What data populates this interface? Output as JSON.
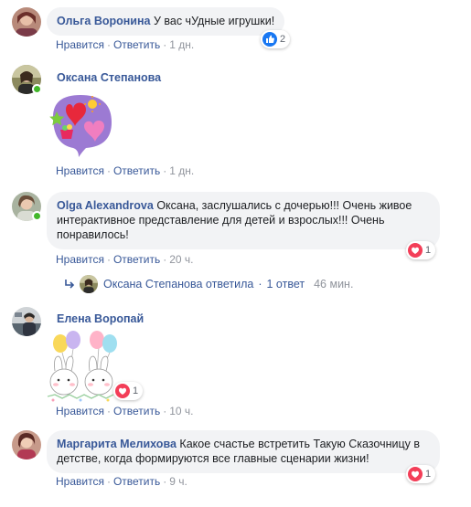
{
  "comments": [
    {
      "author": "Ольга Воронина",
      "text": "У вас чУдные игрушки!",
      "like_label": "Нравится",
      "reply_label": "Ответить",
      "time": "1 дн.",
      "reaction": {
        "icon": "like-icon",
        "count": "2"
      }
    },
    {
      "author": "Оксана Степанова",
      "sticker": "hearts-speech-bubble-sticker",
      "like_label": "Нравится",
      "reply_label": "Ответить",
      "time": "1 дн."
    },
    {
      "author": "Olga Alexandrova",
      "text": "Оксана, заслушались с дочерью!!! Очень живое интерактивное представление для детей и взрослых!!! Очень понравилось!",
      "like_label": "Нравится",
      "reply_label": "Ответить",
      "time": "20 ч.",
      "reaction": {
        "icon": "love-icon",
        "count": "1"
      },
      "replies": {
        "author_replied": "Оксана Степанова ответила",
        "count_label": "1 ответ",
        "time": "46 мин."
      }
    },
    {
      "author": "Елена Воропай",
      "sticker": "bunnies-balloons-sticker",
      "like_label": "Нравится",
      "reply_label": "Ответить",
      "time": "10 ч.",
      "reaction": {
        "icon": "love-icon",
        "count": "1"
      }
    },
    {
      "author": "Маргарита Мелихова",
      "text": "Какое счастье встретить Такую Сказочницу в детстве, когда формируются все главные сценарии жизни!",
      "like_label": "Нравится",
      "reply_label": "Ответить",
      "time": "9 ч.",
      "reaction": {
        "icon": "love-icon",
        "count": "1"
      }
    }
  ],
  "separator": "·",
  "colors": {
    "link": "#385898",
    "bubble": "#f2f3f5",
    "meta": "#90949c",
    "online": "#42b72a",
    "like": "#1877f2",
    "love": "#f33e58"
  }
}
